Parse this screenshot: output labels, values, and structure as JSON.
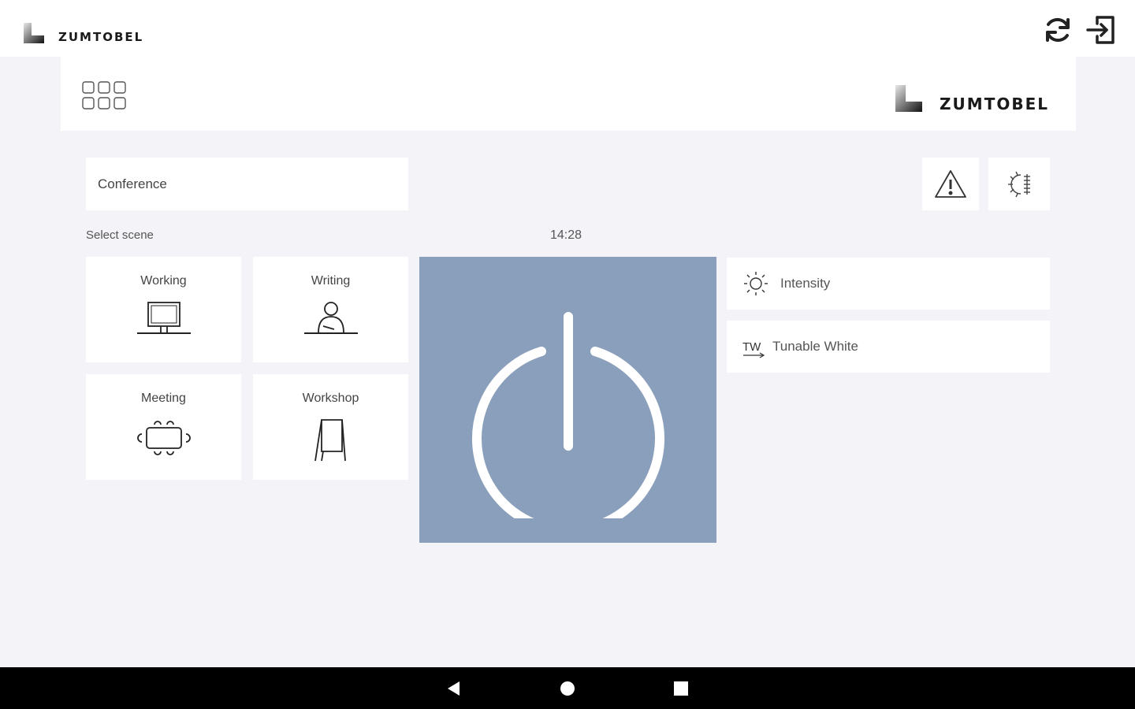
{
  "brand": {
    "name": "ZUMTOBEL"
  },
  "topbar": {
    "icons": [
      "zumtobel-logo-icon",
      "refresh-icon",
      "logout-icon"
    ]
  },
  "header": {
    "grid_icon": "app-grid-icon",
    "brand": "ZUMTOBEL"
  },
  "room": {
    "value": "Conference"
  },
  "tools": {
    "warning_icon": "warning-icon",
    "settings_icon": "light-settings-icon"
  },
  "scenes": {
    "label": "Select scene",
    "clock": "14:28",
    "items": [
      {
        "label": "Working",
        "icon": "monitor-desk-icon"
      },
      {
        "label": "Writing",
        "icon": "person-writing-icon"
      },
      {
        "label": "Meeting",
        "icon": "meeting-table-icon"
      },
      {
        "label": "Workshop",
        "icon": "flipchart-icon"
      }
    ]
  },
  "power": {
    "icon": "power-icon",
    "color": "#8a9fbb"
  },
  "controls": [
    {
      "label": "Intensity",
      "icon": "sun-icon"
    },
    {
      "label": "Tunable White",
      "icon_text": "TW"
    }
  ],
  "android_nav": {
    "icons": [
      "back-icon",
      "home-icon",
      "recents-icon"
    ]
  }
}
